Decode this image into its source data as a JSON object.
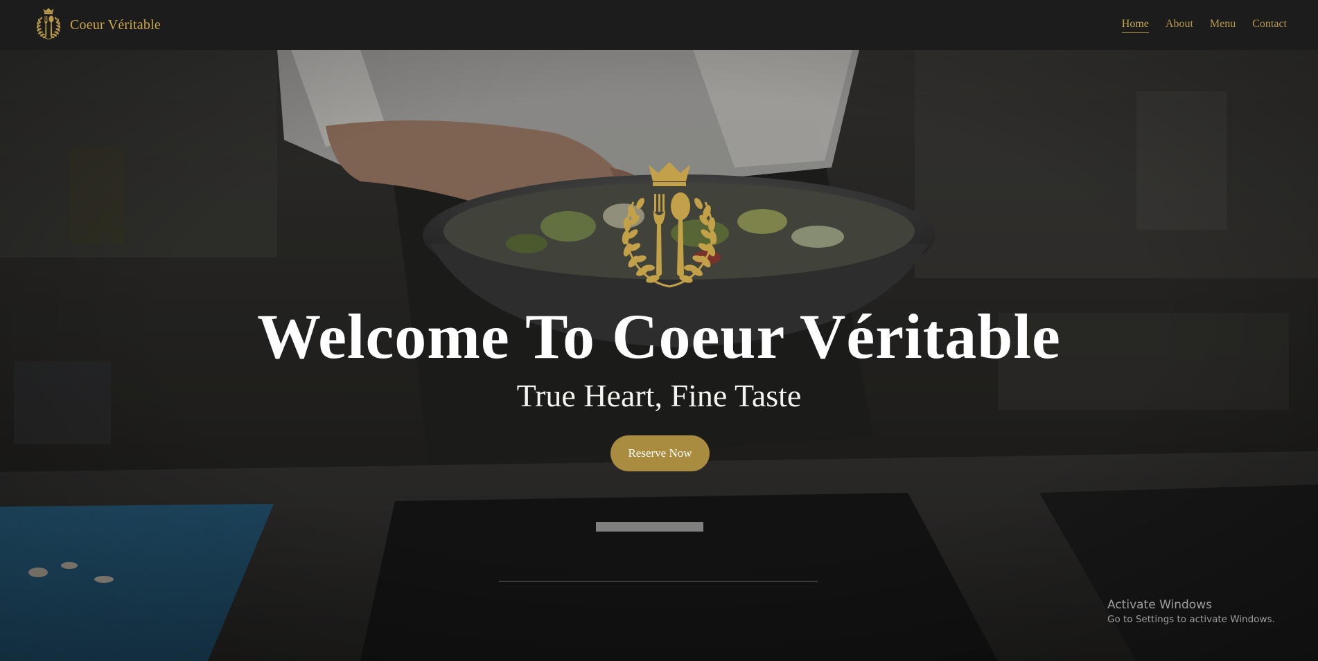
{
  "brand": {
    "name": "Coeur Véritable",
    "logo_icon": "crown-fork-spoon-laurel-icon"
  },
  "nav": {
    "items": [
      {
        "label": "Home",
        "active": true
      },
      {
        "label": "About",
        "active": false
      },
      {
        "label": "Menu",
        "active": false
      },
      {
        "label": "Contact",
        "active": false
      }
    ]
  },
  "hero": {
    "background": "chef tossing salad in steel bowl in a dark kitchen",
    "emblem_icon": "crown-fork-spoon-laurel-icon",
    "title": "Welcome To Coeur Véritable",
    "subtitle": "True Heart, Fine Taste",
    "cta_label": "Reserve Now"
  },
  "watermark": {
    "line1": "Activate Windows",
    "line2": "Go to Settings to activate Windows."
  },
  "colors": {
    "gold": "#c9a74c",
    "button": "#a98c40",
    "navbar": "#1c1c1c"
  }
}
